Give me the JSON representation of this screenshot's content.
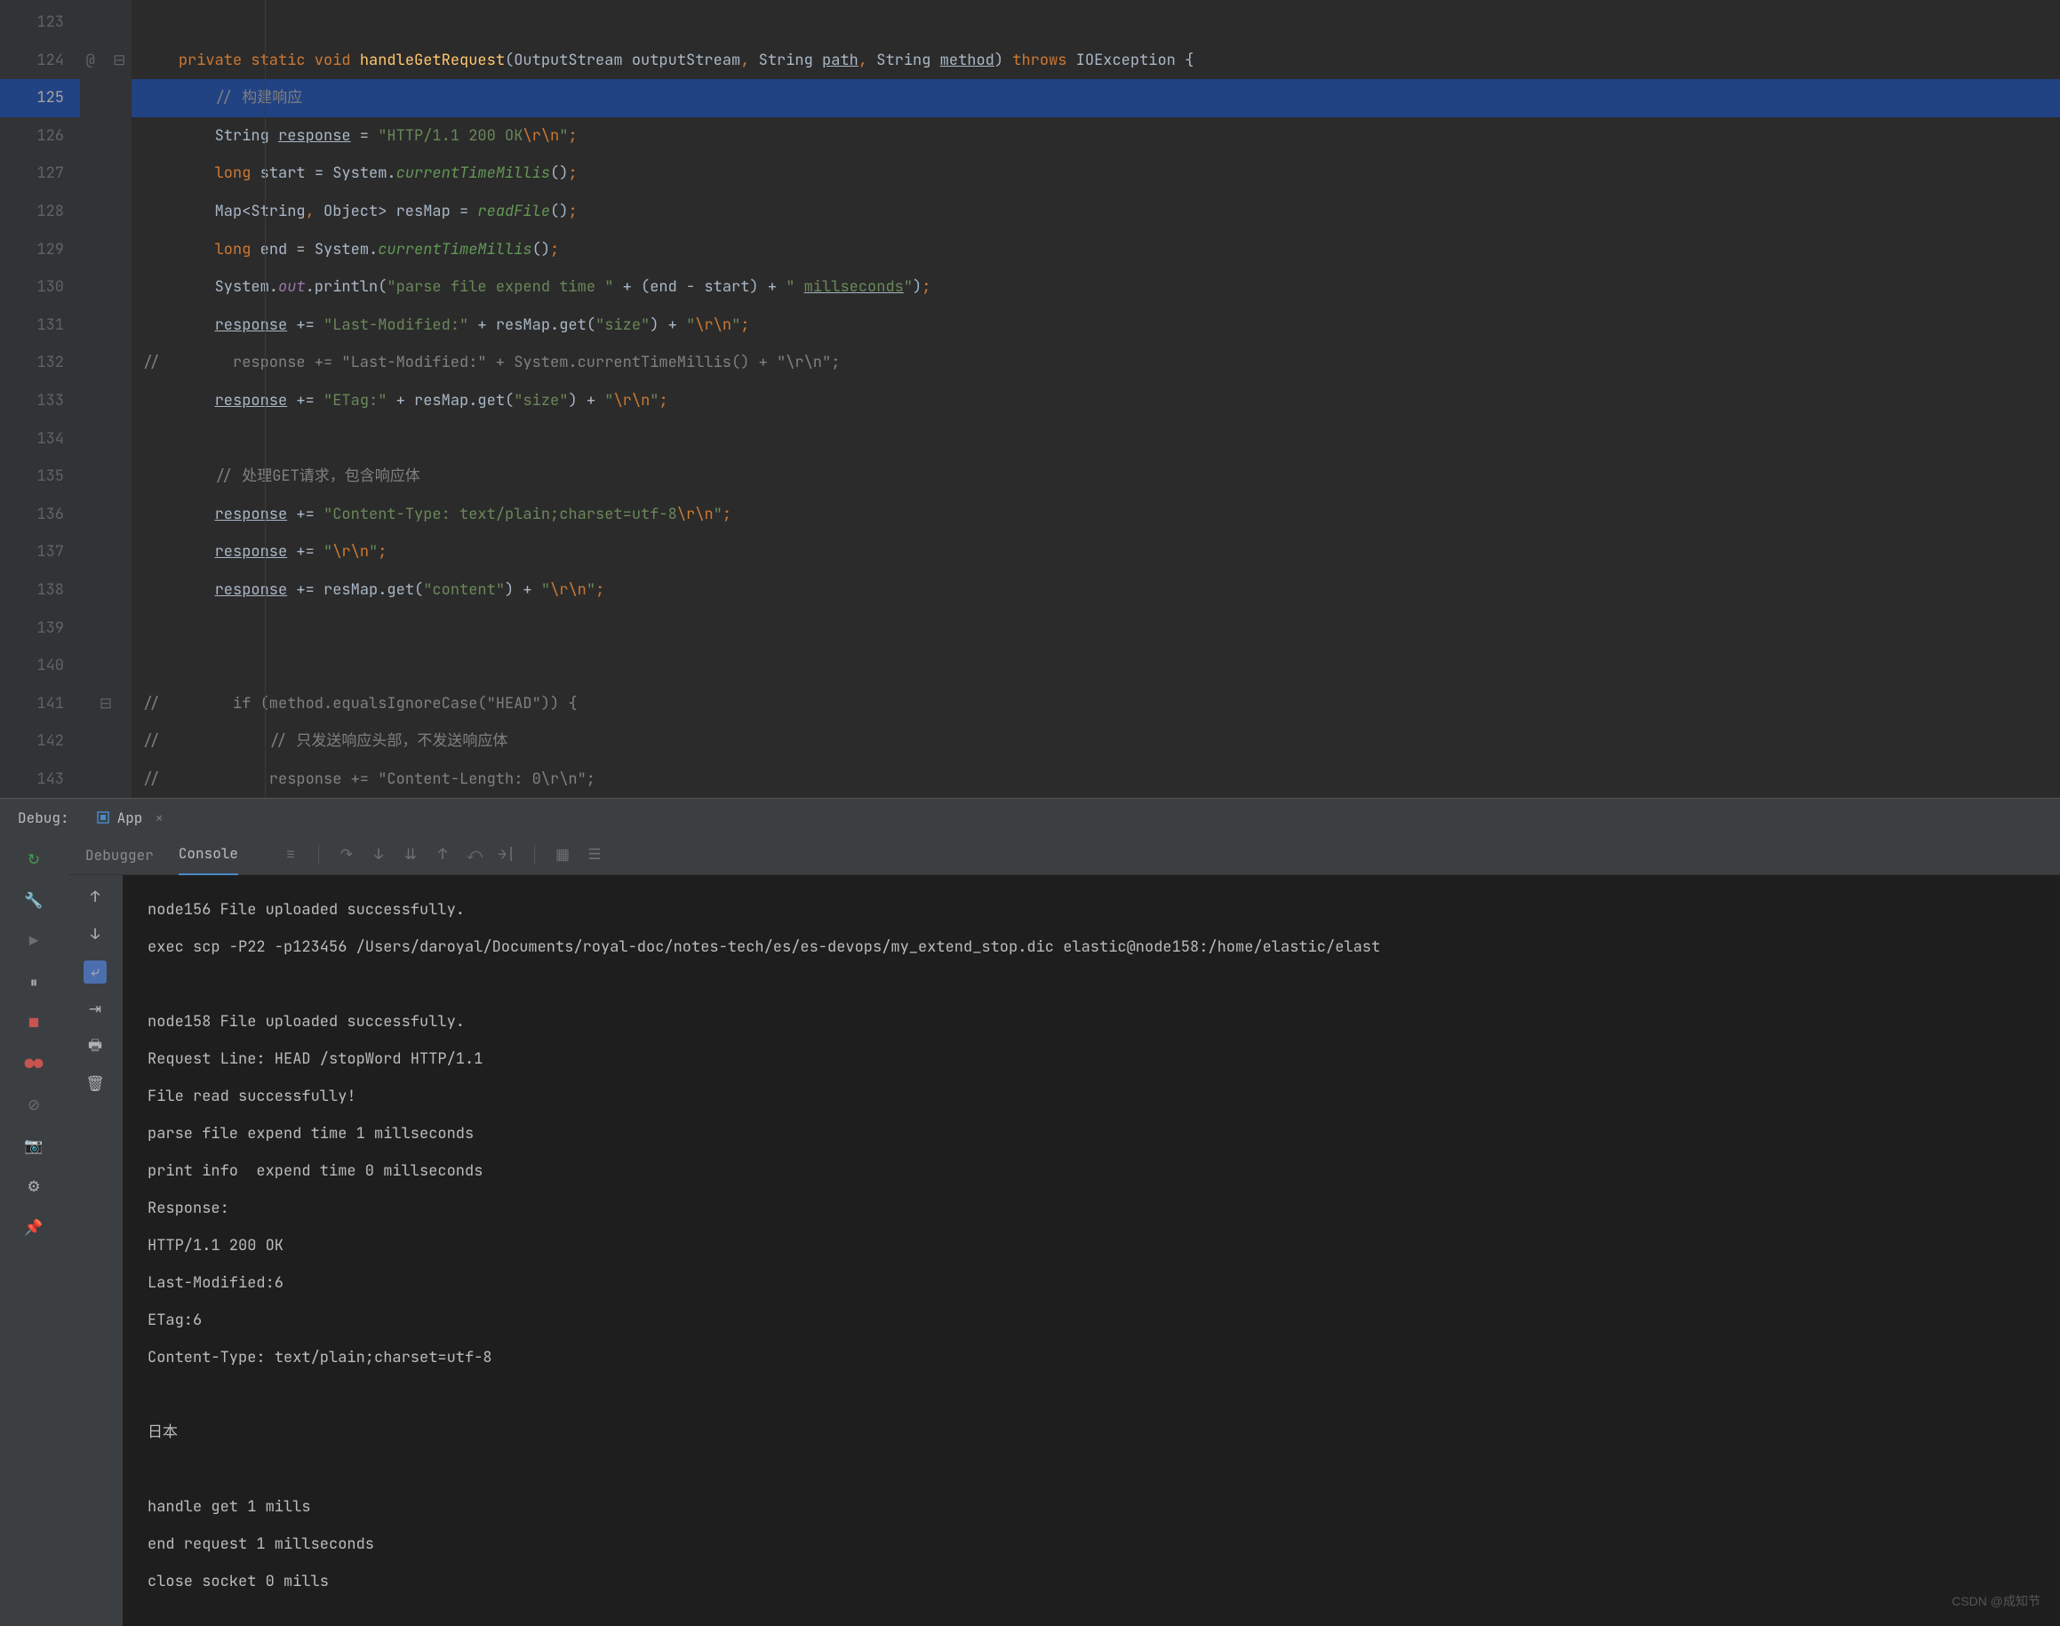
{
  "editor": {
    "startLine": 123,
    "selectedLine": 125,
    "atMarker": "@",
    "lines": [
      {
        "n": 123,
        "html": ""
      },
      {
        "n": 124,
        "html": "    <span class='kw'>private static void</span> <span class='fn'>handleGetRequest</span>(OutputStream outputStream<span class='kw'>,</span> String <span class='und'>path</span><span class='kw'>,</span> String <span class='und'>method</span>) <span class='kw'>throws</span> IOException {"
      },
      {
        "n": 125,
        "html": "        <span class='cmt'>// 构建响应</span>"
      },
      {
        "n": 126,
        "html": "        String <span class='und'>response</span> = <span class='str'>\"HTTP/1.1 200 OK</span><span class='esc'>\\r\\n</span><span class='str'>\"</span><span class='kw'>;</span>"
      },
      {
        "n": 127,
        "html": "        <span class='kw'>long</span> start = System.<span class='cmt2'>currentTimeMillis</span>()<span class='kw'>;</span>"
      },
      {
        "n": 128,
        "html": "        Map&lt;String<span class='kw'>,</span> Object&gt; resMap = <span class='cmt2'>readFile</span>()<span class='kw'>;</span>"
      },
      {
        "n": 129,
        "html": "        <span class='kw'>long</span> end = System.<span class='cmt2'>currentTimeMillis</span>()<span class='kw'>;</span>"
      },
      {
        "n": 130,
        "html": "        System.<span class='field'>out</span>.println(<span class='str'>\"parse file expend time \"</span> + (end - start) + <span class='str'>\" </span><span class='und str'>millseconds</span><span class='str'>\"</span>)<span class='kw'>;</span>"
      },
      {
        "n": 131,
        "html": "        <span class='und'>response</span> += <span class='str'>\"Last-Modified:\"</span> + resMap.get(<span class='str'>\"size\"</span>) + <span class='str'>\"</span><span class='esc'>\\r\\n</span><span class='str'>\"</span><span class='kw'>;</span>"
      },
      {
        "n": 132,
        "html": "<span class='cmt'>//        response += \"Last-Modified:\" + System.currentTimeMillis() + \"\\r\\n\";</span>"
      },
      {
        "n": 133,
        "html": "        <span class='und'>response</span> += <span class='str'>\"ETag:\"</span> + resMap.get(<span class='str'>\"size\"</span>) + <span class='str'>\"</span><span class='esc'>\\r\\n</span><span class='str'>\"</span><span class='kw'>;</span>"
      },
      {
        "n": 134,
        "html": ""
      },
      {
        "n": 135,
        "html": "        <span class='cmt'>// 处理GET请求，包含响应体</span>"
      },
      {
        "n": 136,
        "html": "        <span class='und'>response</span> += <span class='str'>\"Content-Type: text/plain;charset=utf-8</span><span class='esc'>\\r\\n</span><span class='str'>\"</span><span class='kw'>;</span>"
      },
      {
        "n": 137,
        "html": "        <span class='und'>response</span> += <span class='str'>\"</span><span class='esc'>\\r\\n</span><span class='str'>\"</span><span class='kw'>;</span>"
      },
      {
        "n": 138,
        "html": "        <span class='und'>response</span> += resMap.get(<span class='str'>\"content\"</span>) + <span class='str'>\"</span><span class='esc'>\\r\\n</span><span class='str'>\"</span><span class='kw'>;</span>"
      },
      {
        "n": 139,
        "html": ""
      },
      {
        "n": 140,
        "html": ""
      },
      {
        "n": 141,
        "html": "<span class='cmt'>//        if (method.equalsIgnoreCase(\"HEAD\")) {</span>"
      },
      {
        "n": 142,
        "html": "<span class='cmt'>//            // 只发送响应头部，不发送响应体</span>"
      },
      {
        "n": 143,
        "html": "<span class='cmt'>//            response += \"Content-Length: 0\\r\\n\";</span>"
      }
    ]
  },
  "debugBar": {
    "label": "Debug:",
    "tab": "App"
  },
  "debugTabs": {
    "debugger": "Debugger",
    "console": "Console"
  },
  "console": {
    "lines": [
      "node156 File uploaded successfully.",
      "exec scp -P22 -p123456 /Users/daroyal/Documents/royal-doc/notes-tech/es/es-devops/my_extend_stop.dic elastic@node158:/home/elastic/elast",
      "",
      "node158 File uploaded successfully.",
      "Request Line: HEAD /stopWord HTTP/1.1",
      "File read successfully!",
      "parse file expend time 1 millseconds",
      "print info  expend time 0 millseconds",
      "Response:",
      "HTTP/1.1 200 OK",
      "Last-Modified:6",
      "ETag:6",
      "Content-Type: text/plain;charset=utf-8",
      "",
      "日本",
      "",
      "handle get 1 mills",
      "end request 1 millseconds",
      "close socket 0 mills"
    ]
  },
  "watermark": "CSDN @成知节"
}
